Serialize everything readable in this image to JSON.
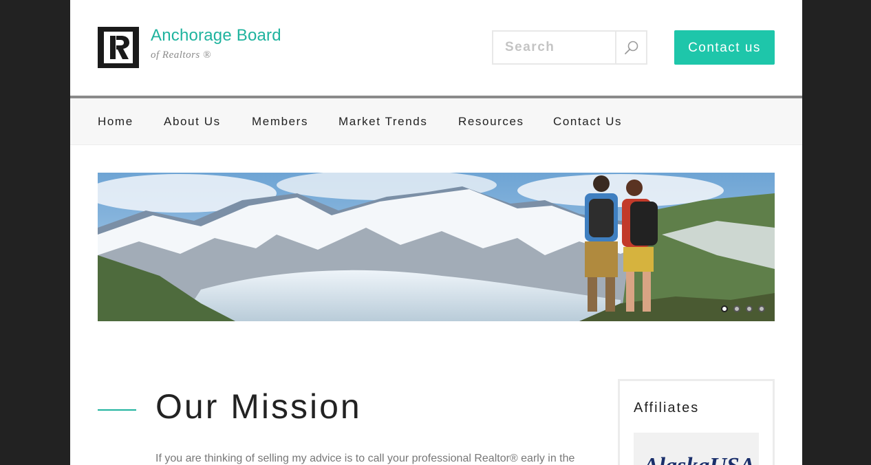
{
  "colors": {
    "accent": "#1fb39e",
    "button": "#1ec6aa",
    "backdrop": "#222222",
    "text": "#222222",
    "muted": "#777777"
  },
  "brand": {
    "logo_icon": "realtor-r-icon",
    "title": "Anchorage Board",
    "subtitle": "of Realtors ®"
  },
  "search": {
    "placeholder": "Search",
    "value": "",
    "icon": "search-icon"
  },
  "header": {
    "contact_label": "Contact us"
  },
  "nav": {
    "items": [
      {
        "label": "Home"
      },
      {
        "label": "About Us"
      },
      {
        "label": "Members"
      },
      {
        "label": "Market Trends"
      },
      {
        "label": "Resources"
      },
      {
        "label": "Contact Us"
      }
    ]
  },
  "hero": {
    "slide_count": 4,
    "active_slide": 1
  },
  "mission": {
    "title": "Our Mission",
    "text": "If you are thinking of selling my advice is to call your professional Realtor® early in the"
  },
  "affiliates": {
    "title": "Affiliates",
    "logo_text": "AlaskaUSA"
  }
}
